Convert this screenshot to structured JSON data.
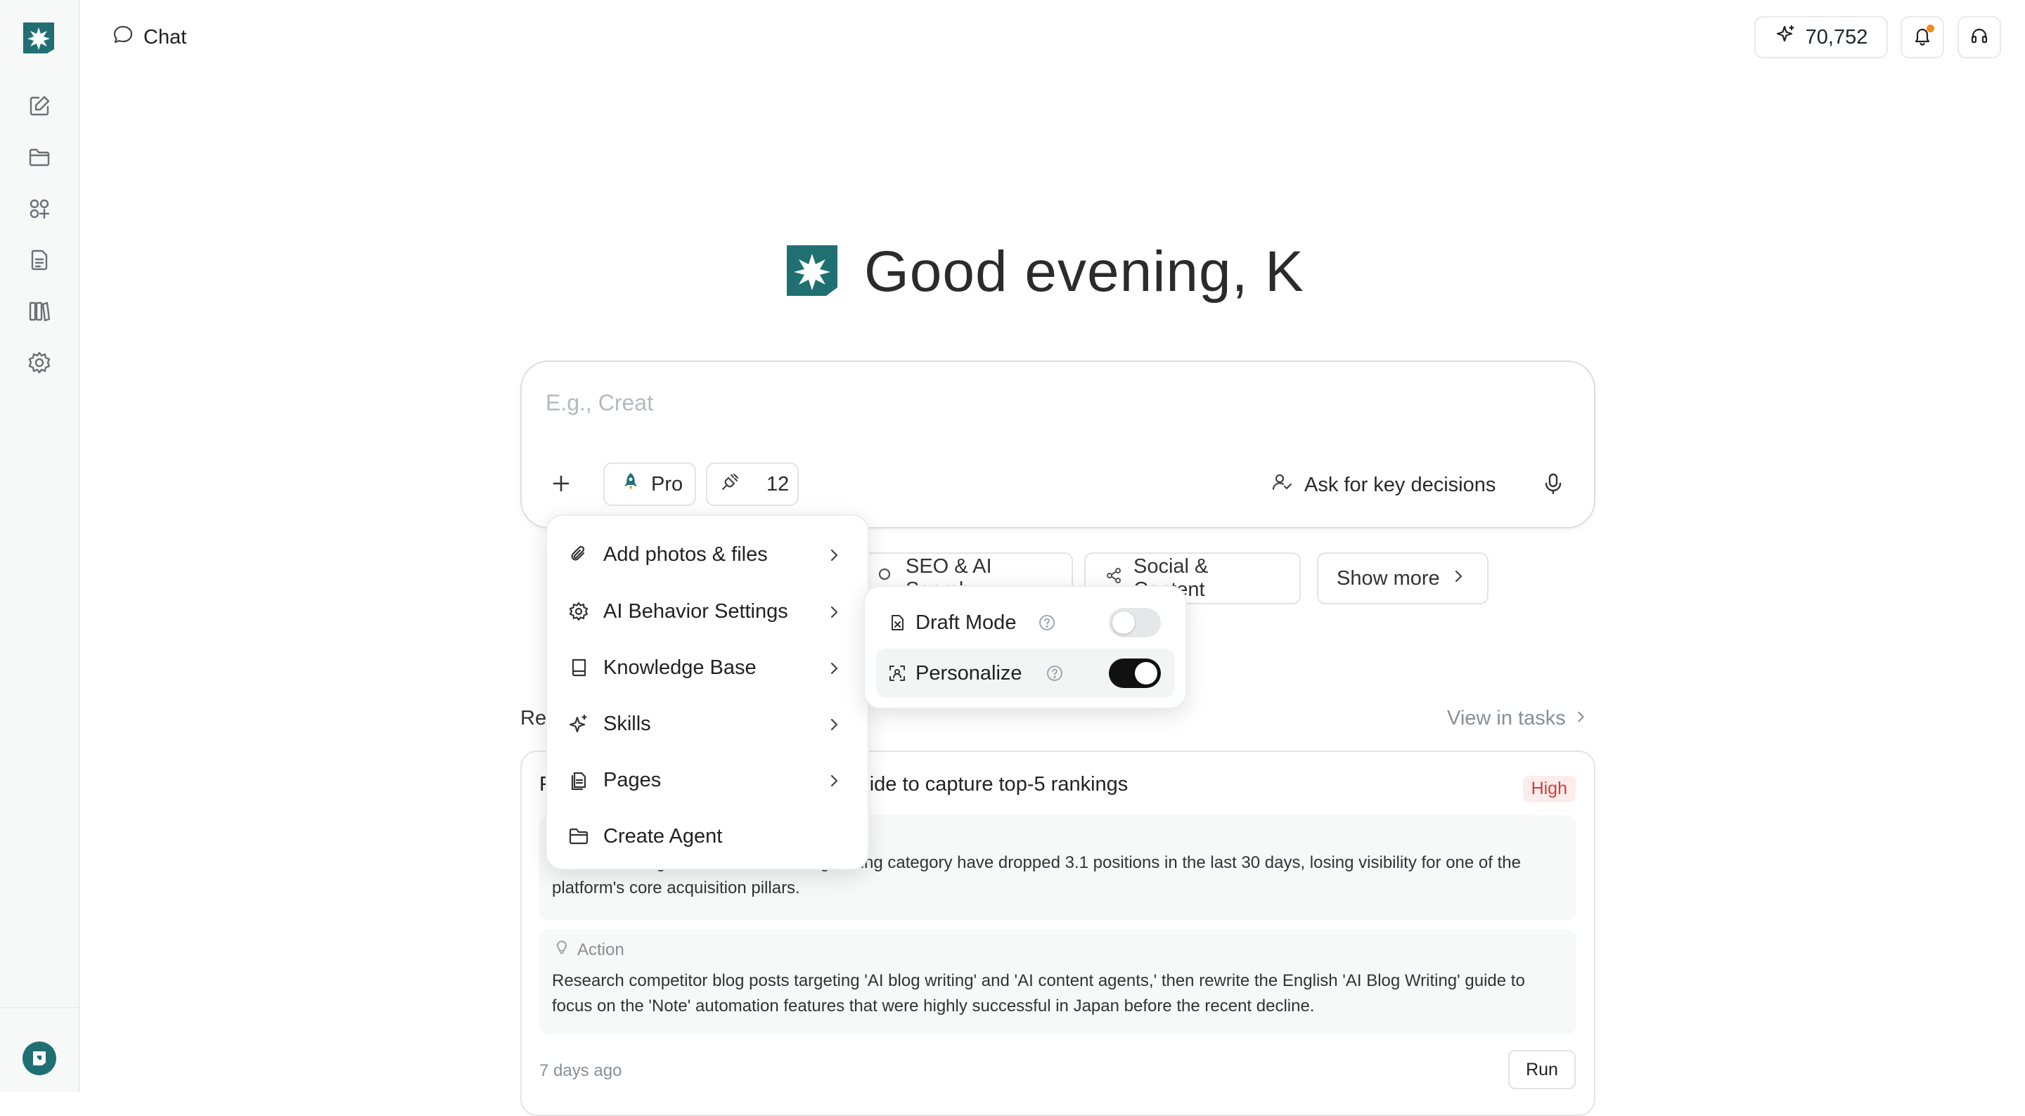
{
  "header": {
    "title": "Chat",
    "credits": "70,752"
  },
  "colors": {
    "brand": "#1f6f73",
    "notification_dot": "#f08a1a",
    "priority_high": "#d33c3c"
  },
  "sidebar": {
    "items": [
      {
        "icon": "new-chat-icon"
      },
      {
        "icon": "folder-icon"
      },
      {
        "icon": "apps-icon"
      },
      {
        "icon": "documents-icon"
      },
      {
        "icon": "library-icon"
      },
      {
        "icon": "settings-icon"
      }
    ]
  },
  "greeting": "Good evening, K",
  "composer": {
    "placeholder": "E.g., Creat",
    "mode_label": "Pro",
    "tools_count": "12",
    "ask_label": "Ask for key decisions"
  },
  "quick_tags": [
    {
      "label": "SEO & AI Search"
    },
    {
      "label": "Social & Content"
    },
    {
      "label": "Show more"
    }
  ],
  "recent": {
    "label": "Re",
    "view_label": "View in tasks",
    "card": {
      "title_prefix": "F",
      "title": "ide to capture top-5 rankings",
      "priority": "High",
      "issue_text": "Search rankings for the 'Note AI' blog writing category have dropped 3.1 positions in the last 30 days, losing visibility for one of the platform's core acquisition pillars.",
      "action_label": "Action",
      "action_text": "Research competitor blog posts targeting 'AI blog writing' and 'AI content agents,' then rewrite the English 'AI Blog Writing' guide to focus on the 'Note' automation features that were highly successful in Japan before the recent decline.",
      "time": "7 days ago",
      "run_label": "Run"
    }
  },
  "menu": {
    "items": [
      {
        "label": "Add photos & files",
        "icon": "paperclip-icon",
        "has_submenu": true
      },
      {
        "label": "AI Behavior Settings",
        "icon": "gear-icon",
        "has_submenu": true
      },
      {
        "label": "Knowledge Base",
        "icon": "book-icon",
        "has_submenu": true
      },
      {
        "label": "Skills",
        "icon": "sparkle-icon",
        "has_submenu": true
      },
      {
        "label": "Pages",
        "icon": "pages-icon",
        "has_submenu": true
      },
      {
        "label": "Create Agent",
        "icon": "folder-icon",
        "has_submenu": false
      }
    ]
  },
  "submenu": {
    "items": [
      {
        "label": "Draft Mode",
        "icon": "draft-icon",
        "enabled": false
      },
      {
        "label": "Personalize",
        "icon": "personalize-icon",
        "enabled": true
      }
    ]
  }
}
